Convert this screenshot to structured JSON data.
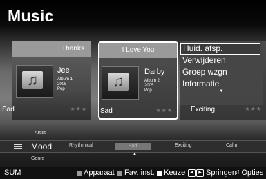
{
  "title": "Music",
  "cards": [
    {
      "song": "Thanks",
      "artist": "Jee",
      "album": "Album 1",
      "year": "2005",
      "genre": "Pop",
      "mood": "Sad",
      "stars": "★★★"
    },
    {
      "song": "I Love You",
      "artist": "Darby",
      "album": "Album 2",
      "year": "2005",
      "genre": "Pop",
      "mood": "Sad",
      "stars": "★★★"
    },
    {
      "mood": "Exciting",
      "stars": "★★★"
    }
  ],
  "context_menu": {
    "items": [
      "Huid. afsp.",
      "Verwijderen",
      "Groep wzgn",
      "Informatie"
    ],
    "more": "▼"
  },
  "category": {
    "above": "Artist",
    "current": "Mood",
    "below": "Genre",
    "options": [
      "Rhythmical",
      "Sad",
      "Exciting",
      "Calm"
    ],
    "selected_caret": "▲"
  },
  "footer": {
    "sum": "SUM",
    "device": "Apparaat",
    "fav": "Fav. inst.",
    "select": "Keuze",
    "jump": "Springen",
    "options": "Opties"
  },
  "colors": {
    "selected_border": "#ffffff",
    "header_bar": "#9a9a9a"
  }
}
